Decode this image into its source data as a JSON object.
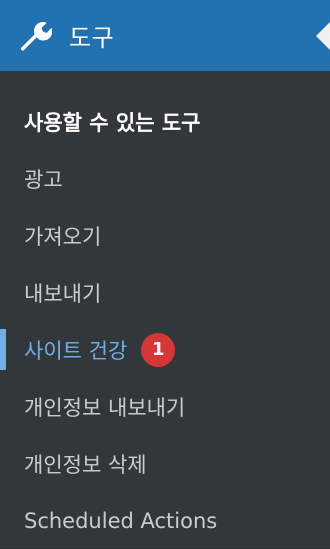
{
  "menu": {
    "title": "도구",
    "icon": "wrench-icon",
    "accent_color": "#2271b1",
    "items": [
      {
        "label": "사용할 수 있는 도구"
      },
      {
        "label": "광고"
      },
      {
        "label": "가져오기"
      },
      {
        "label": "내보내기"
      },
      {
        "label": "사이트 건강",
        "badge": "1",
        "active": true
      },
      {
        "label": "개인정보 내보내기"
      },
      {
        "label": "개인정보 삭제"
      },
      {
        "label": "Scheduled Actions"
      }
    ]
  }
}
